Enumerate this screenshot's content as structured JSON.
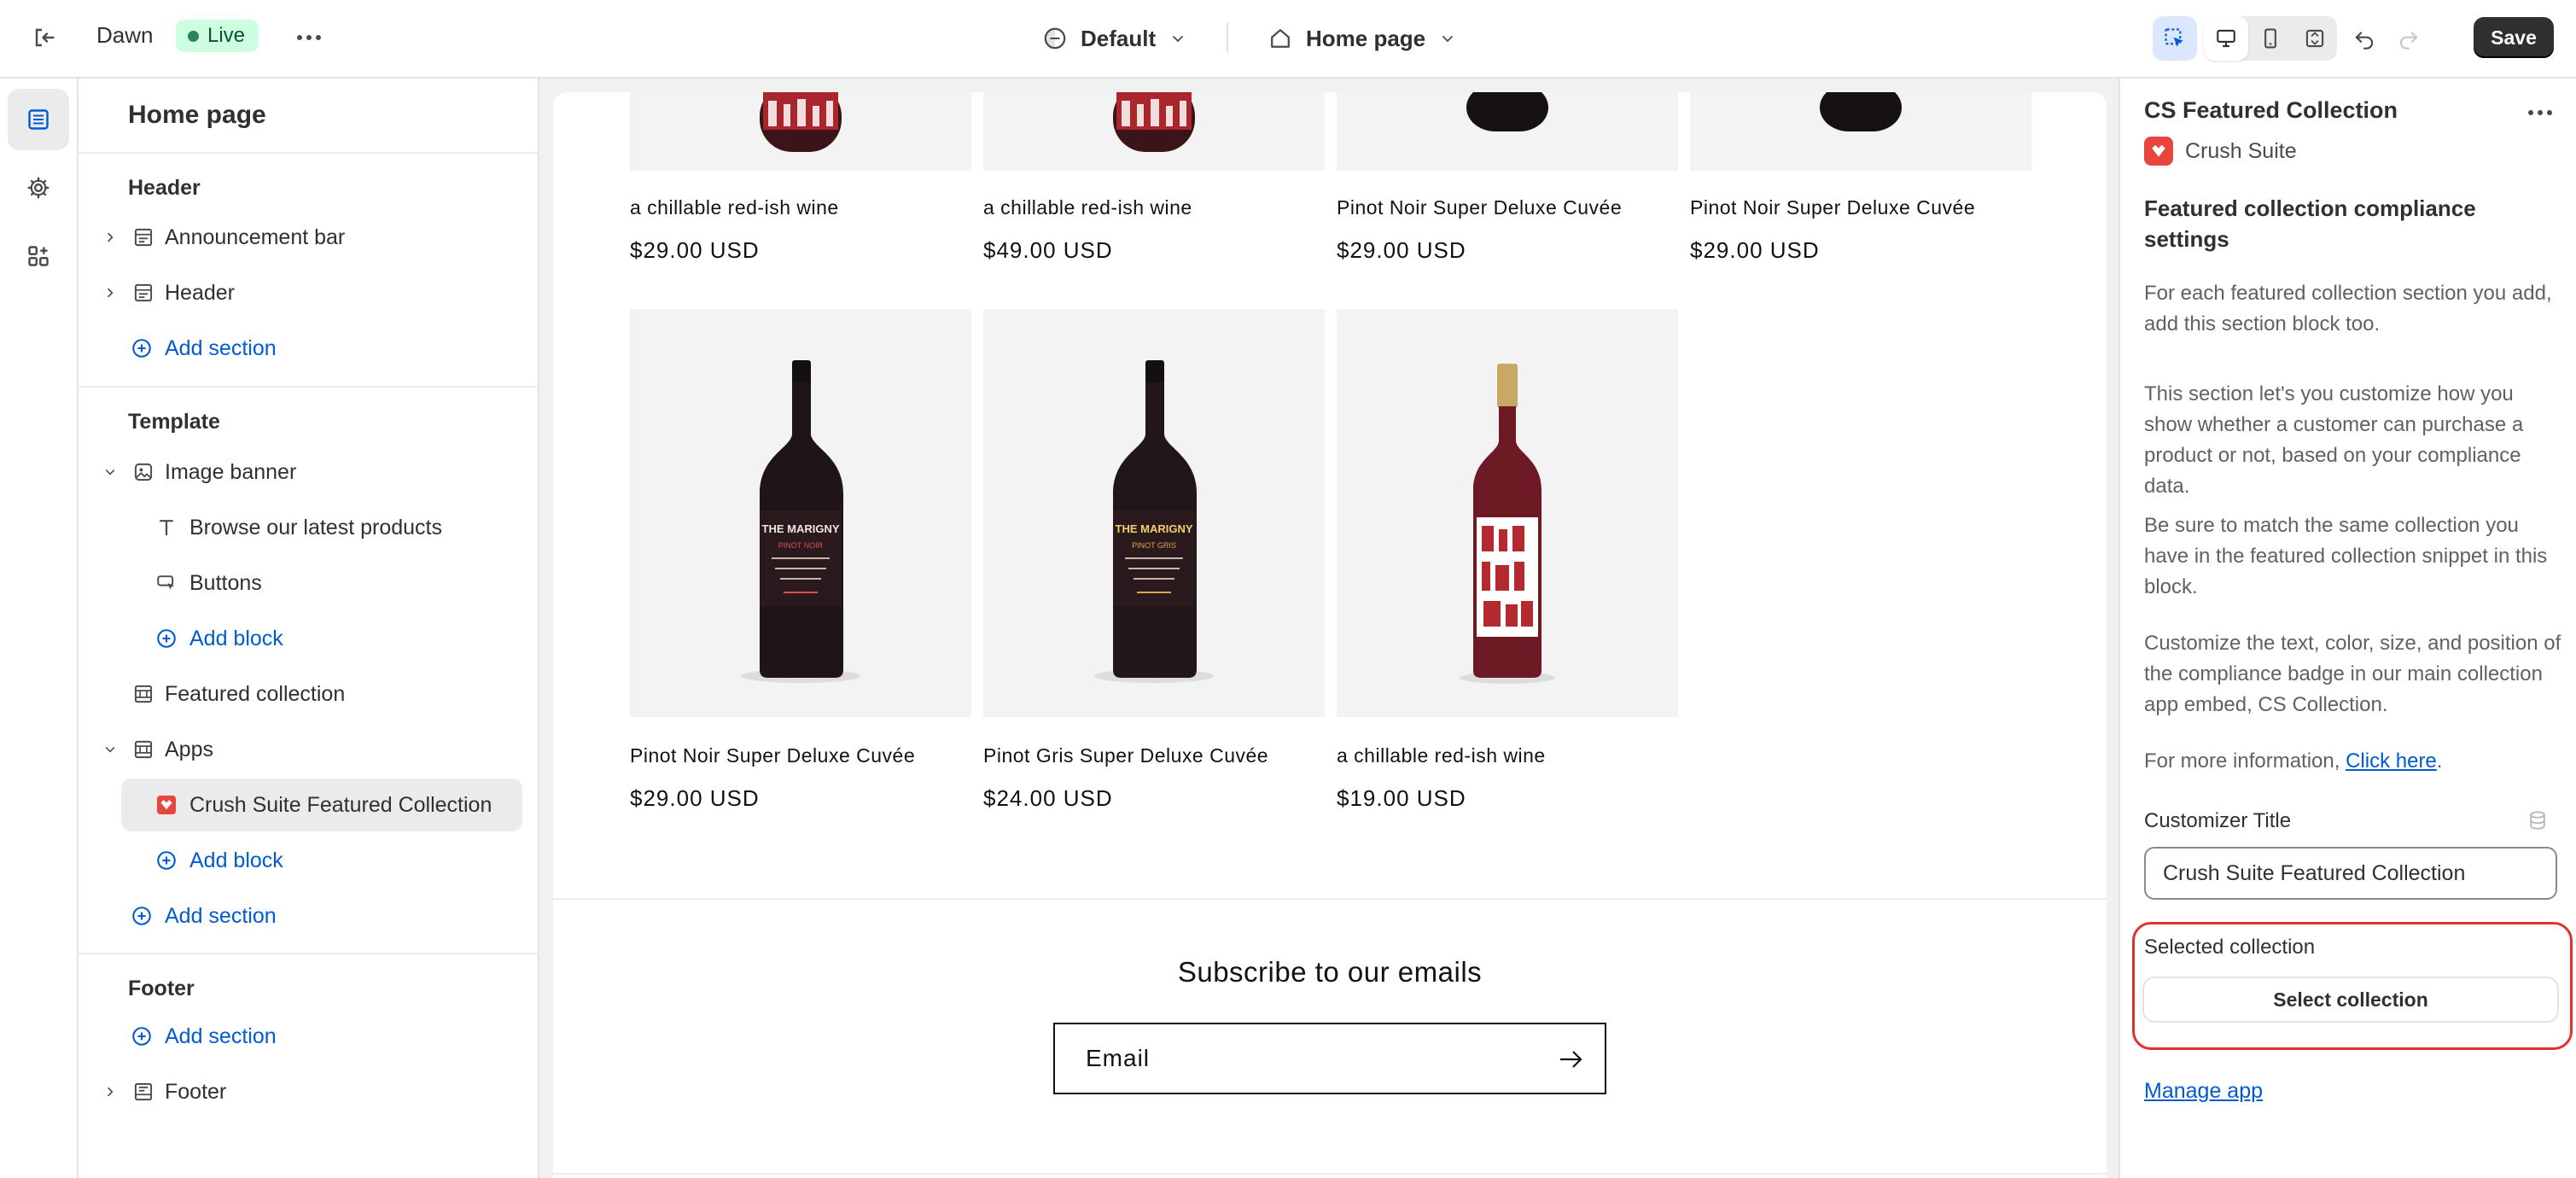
{
  "topbar": {
    "theme_name": "Dawn",
    "status_badge": "Live",
    "template_selector": "Default",
    "page_selector": "Home page",
    "save_label": "Save"
  },
  "sidebar": {
    "title": "Home page",
    "header_group": "Header",
    "header_items": [
      "Announcement bar",
      "Header"
    ],
    "template_group": "Template",
    "image_banner": "Image banner",
    "image_banner_blocks": [
      "Browse our latest products",
      "Buttons"
    ],
    "featured_collection": "Featured collection",
    "apps": "Apps",
    "app_block": "Crush Suite Featured Collection",
    "footer_group": "Footer",
    "footer_item": "Footer",
    "add_section": "Add section",
    "add_block": "Add block"
  },
  "preview": {
    "row1": [
      {
        "name": "a chillable red-ish wine",
        "price": "$29.00 USD"
      },
      {
        "name": "a chillable red-ish wine",
        "price": "$49.00 USD"
      },
      {
        "name": "Pinot Noir Super Deluxe Cuvée",
        "price": "$29.00 USD"
      },
      {
        "name": "Pinot Noir Super Deluxe Cuvée",
        "price": "$29.00 USD"
      }
    ],
    "row2": [
      {
        "name": "Pinot Noir Super Deluxe Cuvée",
        "price": "$29.00 USD",
        "label": "THE MARIGNY",
        "sublabel": "PINOT NOIR"
      },
      {
        "name": "Pinot Gris Super Deluxe Cuvée",
        "price": "$24.00 USD",
        "label": "THE MARIGNY",
        "sublabel": "PINOT GRIS"
      },
      {
        "name": "a chillable red-ish wine",
        "price": "$19.00 USD"
      }
    ],
    "subscribe_title": "Subscribe to our emails",
    "email_placeholder": "Email"
  },
  "panel": {
    "title": "CS Featured Collection",
    "app_name": "Crush Suite",
    "heading": "Featured collection compliance settings",
    "p1": "For each featured collection section you add, add this section block too.",
    "p2": "This section let's you customize how you show whether a customer can purchase a product or not, based on your compliance data.",
    "p3": "Be sure to match the same collection you have in the featured collection snippet in this block.",
    "p4": "Customize the text, color, size, and position of the compliance badge in our main collection app embed, CS Collection.",
    "p5_prefix": "For more information, ",
    "p5_link": "Click here",
    "p5_suffix": ".",
    "customizer_title_label": "Customizer Title",
    "customizer_title_value": "Crush Suite Featured Collection",
    "selected_collection_label": "Selected collection",
    "select_collection_button": "Select collection",
    "manage_app": "Manage app"
  },
  "colors": {
    "accent_link": "#005bd3",
    "live_badge_bg": "#cdfee1",
    "highlight_border": "#e0342b",
    "save_button": "#303030"
  }
}
